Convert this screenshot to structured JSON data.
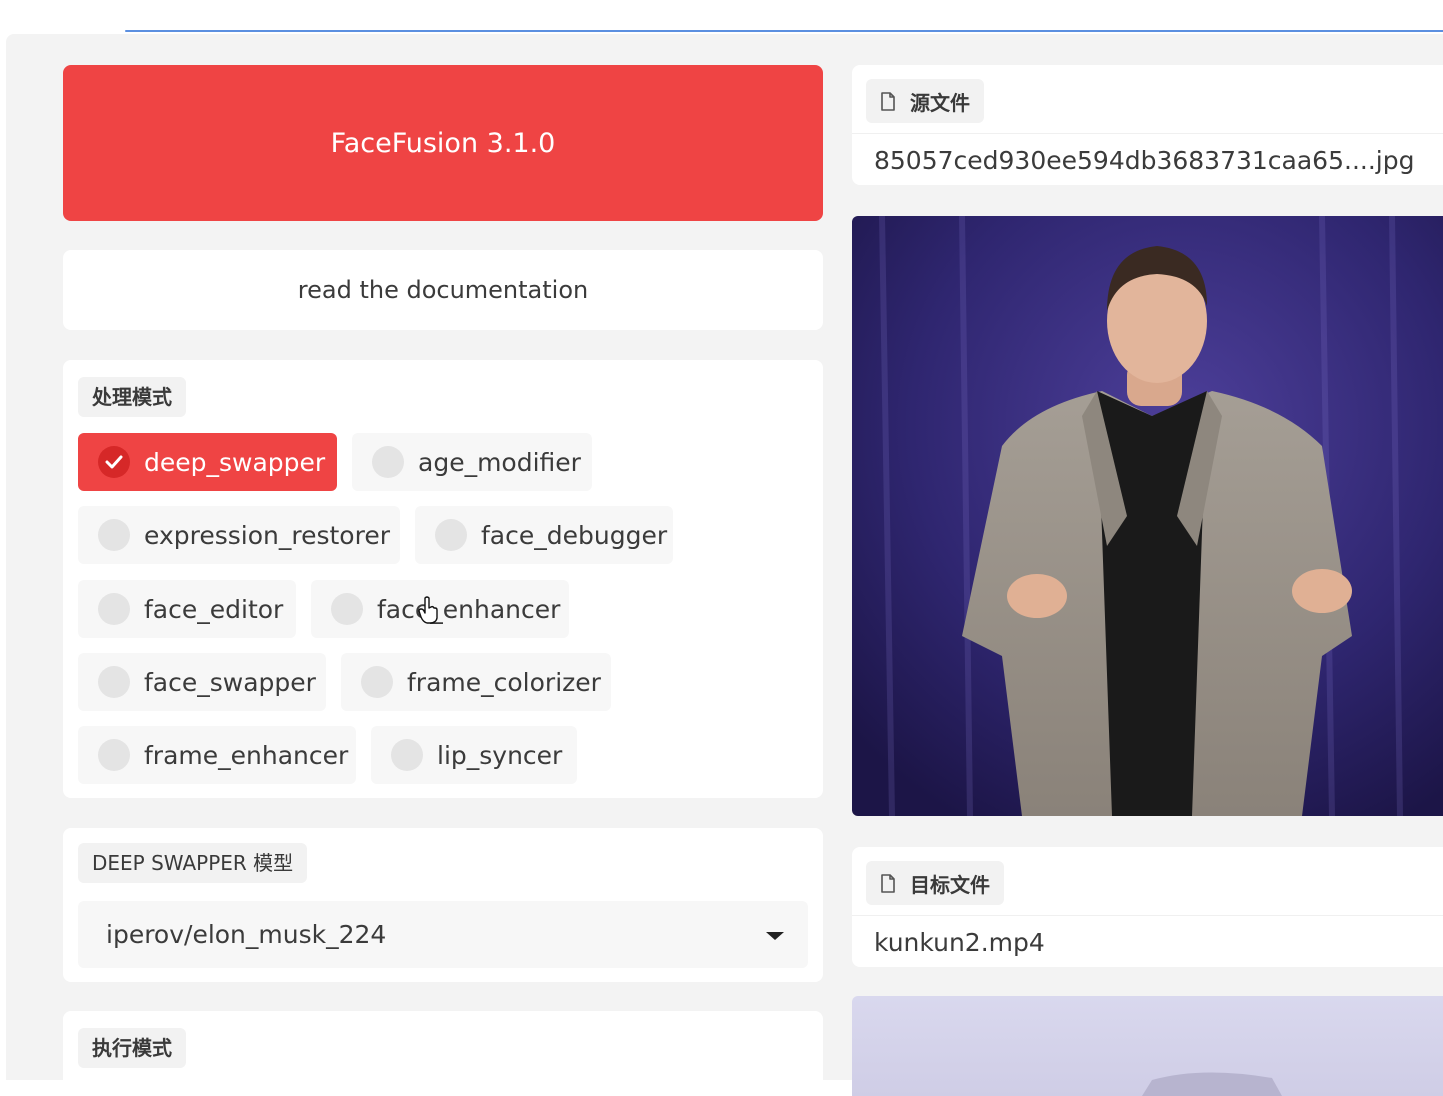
{
  "app": {
    "title": "FaceFusion 3.1.0",
    "doc_link": "read the documentation"
  },
  "processors": {
    "label": "处理模式",
    "options": [
      {
        "label": "deep_swapper",
        "selected": true
      },
      {
        "label": "age_modifier",
        "selected": false
      },
      {
        "label": "expression_restorer",
        "selected": false
      },
      {
        "label": "face_debugger",
        "selected": false
      },
      {
        "label": "face_editor",
        "selected": false
      },
      {
        "label": "face_enhancer",
        "selected": false
      },
      {
        "label": "face_swapper",
        "selected": false
      },
      {
        "label": "frame_colorizer",
        "selected": false
      },
      {
        "label": "frame_enhancer",
        "selected": false
      },
      {
        "label": "lip_syncer",
        "selected": false
      }
    ]
  },
  "deep_swapper_model": {
    "label": "DEEP SWAPPER 模型",
    "value": "iperov/elon_musk_224"
  },
  "execution": {
    "label": "执行模式"
  },
  "source": {
    "label": "源文件",
    "icon": "file-icon",
    "filename": "85057ced930ee594db3683731caa65....jpg"
  },
  "target": {
    "label": "目标文件",
    "icon": "file-icon",
    "filename": "kunkun2.mp4"
  },
  "colors": {
    "accent": "#ef4444",
    "background": "#f3f3f3",
    "focus_line": "#5b8fe0"
  }
}
